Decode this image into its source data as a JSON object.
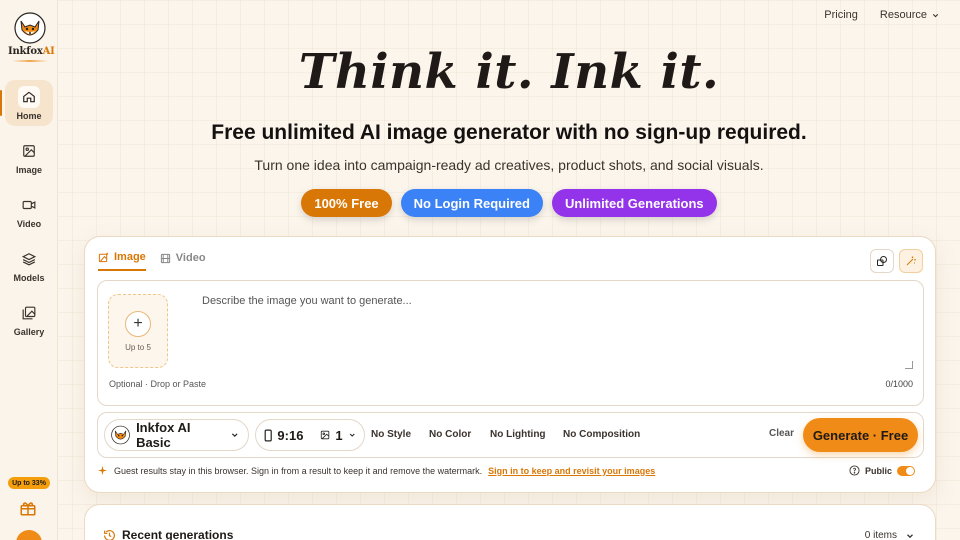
{
  "brand": {
    "name_main": "Inkfox",
    "name_accent": "AI"
  },
  "sidebar": {
    "items": [
      {
        "label": "Home",
        "icon": "home-icon",
        "active": true
      },
      {
        "label": "Image",
        "icon": "image-icon"
      },
      {
        "label": "Video",
        "icon": "video-icon"
      },
      {
        "label": "Models",
        "icon": "layers-icon"
      },
      {
        "label": "Gallery",
        "icon": "gallery-icon"
      }
    ],
    "promo_badge": "Up to 33%"
  },
  "topnav": {
    "pricing": "Pricing",
    "resource": "Resource"
  },
  "hero": {
    "title": "Think it. Ink it.",
    "subtitle": "Free unlimited AI image generator with no sign-up required.",
    "description": "Turn one idea into campaign-ready ad creatives, product shots, and social visuals.",
    "pills": [
      "100% Free",
      "No Login Required",
      "Unlimited Generations"
    ]
  },
  "generator": {
    "tabs": {
      "image": "Image",
      "video": "Video"
    },
    "upload_label": "Up to 5",
    "prompt_placeholder": "Describe the image you want to generate...",
    "drop_hint": "Optional · Drop or Paste",
    "char_count": "0/1000",
    "model": "Inkfox AI Basic",
    "ratio": "9:16",
    "count": "1",
    "options": {
      "style": "No Style",
      "color": "No Color",
      "lighting": "No Lighting",
      "composition": "No Composition"
    },
    "clear_label": "Clear",
    "generate_label": "Generate · Free",
    "note": "Guest results stay in this browser. Sign in from a result to keep it and remove the watermark.",
    "note_link": "Sign in to keep and revisit your images",
    "public_label": "Public",
    "public_on": true
  },
  "recent": {
    "title": "Recent generations",
    "count_label": "0 items"
  },
  "colors": {
    "accent": "#d97706",
    "generate": "#f08b17",
    "blue": "#3b82f6",
    "purple": "#9333ea"
  }
}
